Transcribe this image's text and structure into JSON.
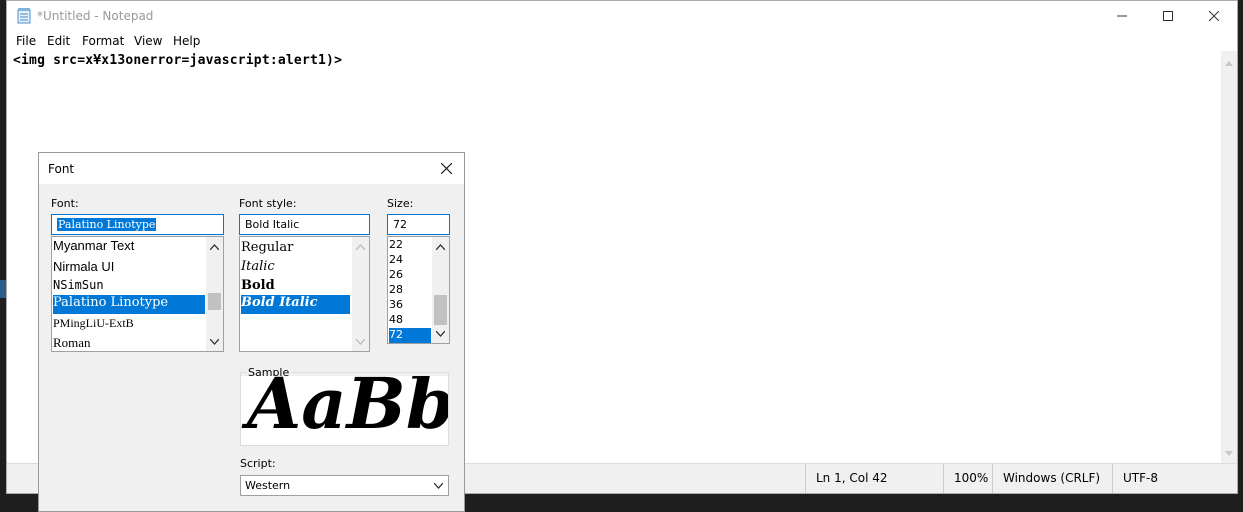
{
  "notepad": {
    "title": "*Untitled - Notepad",
    "menu": [
      "File",
      "Edit",
      "Format",
      "View",
      "Help"
    ],
    "content": "<img src=x¥x13onerror=javascript:alert1)>",
    "status": {
      "position": "Ln 1, Col 42",
      "zoom": "100%",
      "line_endings": "Windows (CRLF)",
      "encoding": "UTF-8"
    }
  },
  "font_dialog": {
    "title": "Font",
    "font_label": "Font:",
    "font_value": "Palatino Linotype",
    "fonts": [
      "Myanmar Text",
      "Nirmala UI",
      "NSimSun",
      "Palatino Linotype",
      "PMingLiU-ExtB",
      "Roman"
    ],
    "style_label": "Font style:",
    "style_value": "Bold Italic",
    "styles": [
      "Regular",
      "Italic",
      "Bold",
      "Bold Italic"
    ],
    "size_label": "Size:",
    "size_value": "72",
    "sizes": [
      "22",
      "24",
      "26",
      "28",
      "36",
      "48",
      "72"
    ],
    "sample_label": "Sample",
    "sample_text": "AaBbYyZz",
    "script_label": "Script:",
    "script_value": "Western"
  },
  "colors": {
    "selection": "#0078d7",
    "dialog_bg": "#f0f0f0"
  }
}
